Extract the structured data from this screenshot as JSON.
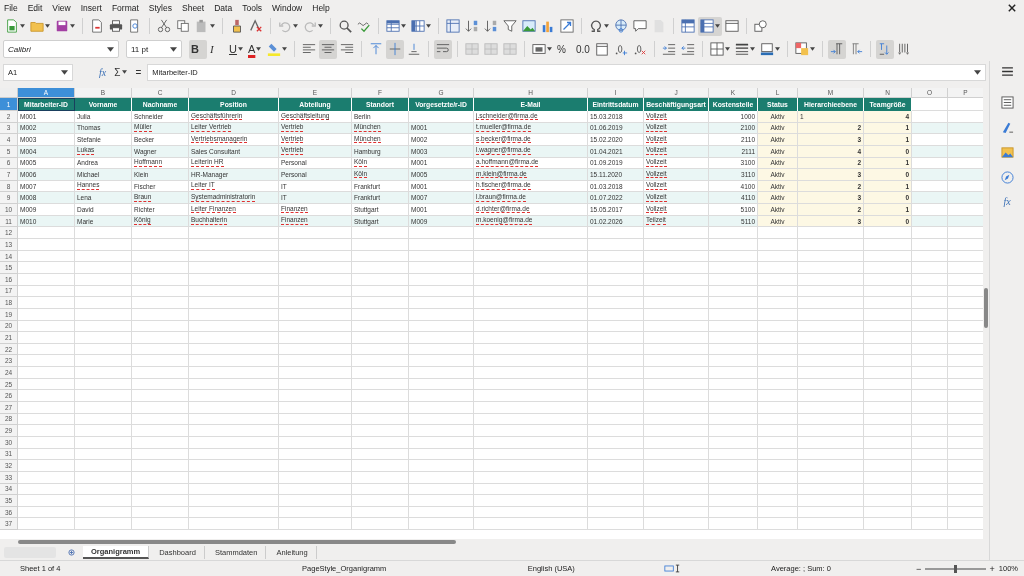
{
  "menu": [
    "File",
    "Edit",
    "View",
    "Insert",
    "Format",
    "Styles",
    "Sheet",
    "Data",
    "Tools",
    "Window",
    "Help"
  ],
  "standard_toolbar": {
    "groups": [
      [
        {
          "kind": "new",
          "pressed": false,
          "menu": true
        },
        {
          "kind": "open",
          "pressed": false,
          "menu": true
        },
        {
          "kind": "save",
          "pressed": false,
          "menu": true
        }
      ],
      [
        {
          "kind": "pdf",
          "pressed": false,
          "menu": false
        },
        {
          "kind": "print",
          "pressed": false,
          "menu": false
        },
        {
          "kind": "preview",
          "pressed": false,
          "menu": false
        }
      ],
      [
        {
          "kind": "cut",
          "pressed": false,
          "menu": false
        },
        {
          "kind": "copy",
          "pressed": false,
          "menu": false
        },
        {
          "kind": "paste",
          "pressed": false,
          "menu": true
        }
      ],
      [
        {
          "kind": "clone",
          "pressed": false,
          "menu": false
        },
        {
          "kind": "clear",
          "pressed": false,
          "menu": false
        }
      ],
      [
        {
          "kind": "undo",
          "pressed": false,
          "menu": true
        },
        {
          "kind": "redo",
          "pressed": false,
          "menu": true
        }
      ],
      [
        {
          "kind": "find",
          "pressed": false,
          "menu": false
        },
        {
          "kind": "spell",
          "pressed": false,
          "menu": false
        }
      ],
      [
        {
          "kind": "rows",
          "pressed": false,
          "menu": true
        },
        {
          "kind": "columns",
          "pressed": false,
          "menu": true
        }
      ],
      [
        {
          "kind": "headers",
          "pressed": false,
          "menu": false
        },
        {
          "kind": "sort-up",
          "pressed": false,
          "menu": false
        },
        {
          "kind": "sort-down",
          "pressed": false,
          "menu": false
        },
        {
          "kind": "filter",
          "pressed": false,
          "menu": false
        },
        {
          "kind": "image",
          "pressed": false,
          "menu": false
        },
        {
          "kind": "chart",
          "pressed": false,
          "menu": false
        },
        {
          "kind": "pivot",
          "pressed": false,
          "menu": false
        }
      ],
      [
        {
          "kind": "omega",
          "pressed": false,
          "menu": true
        },
        {
          "kind": "globe",
          "pressed": false,
          "menu": false
        },
        {
          "kind": "comment",
          "pressed": false,
          "menu": false
        },
        {
          "kind": "page",
          "pressed": false,
          "menu": false
        }
      ],
      [
        {
          "kind": "freeze",
          "pressed": false,
          "menu": false
        },
        {
          "kind": "split",
          "pressed": true,
          "menu": true
        },
        {
          "kind": "window",
          "pressed": false,
          "menu": false
        }
      ],
      [
        {
          "kind": "shapes",
          "pressed": false,
          "menu": false
        }
      ]
    ]
  },
  "formatting_toolbar": {
    "font_name": "Calibri",
    "font_size": "11 pt",
    "groups": [
      [
        {
          "kind": "bold",
          "label": "B",
          "pressed": true,
          "menu": false
        },
        {
          "kind": "italic",
          "label": "I",
          "pressed": false,
          "menu": false
        },
        {
          "kind": "underline",
          "label": "U",
          "pressed": false,
          "menu": true
        },
        {
          "kind": "font-color",
          "label": "A",
          "pressed": false,
          "menu": true
        },
        {
          "kind": "highlight",
          "pressed": false,
          "menu": true
        }
      ],
      [
        {
          "kind": "align-left",
          "pressed": false,
          "menu": false
        },
        {
          "kind": "align-center",
          "pressed": true,
          "menu": false
        },
        {
          "kind": "align-right",
          "pressed": false,
          "menu": false
        }
      ],
      [
        {
          "kind": "align-top",
          "pressed": false,
          "menu": false
        },
        {
          "kind": "align-middle",
          "pressed": true,
          "menu": false
        },
        {
          "kind": "align-bottom",
          "pressed": false,
          "menu": false
        }
      ],
      [
        {
          "kind": "wrap",
          "pressed": true,
          "menu": false
        }
      ],
      [
        {
          "kind": "merge",
          "pressed": false,
          "menu": false
        },
        {
          "kind": "merge",
          "pressed": false,
          "menu": false
        },
        {
          "kind": "merge",
          "pressed": false,
          "menu": false
        }
      ],
      [
        {
          "kind": "currency",
          "pressed": false,
          "menu": true
        },
        {
          "kind": "percent",
          "label": "%",
          "pressed": false,
          "menu": false
        },
        {
          "kind": "decimal",
          "label": "0.0",
          "pressed": false,
          "menu": false
        },
        {
          "kind": "date",
          "pressed": false,
          "menu": false
        },
        {
          "kind": "add-decimal",
          "pressed": false,
          "menu": false
        },
        {
          "kind": "remove-decimal",
          "pressed": false,
          "menu": false
        }
      ],
      [
        {
          "kind": "indent",
          "pressed": false,
          "menu": false
        },
        {
          "kind": "outdent",
          "pressed": false,
          "menu": false
        }
      ],
      [
        {
          "kind": "borders",
          "pressed": false,
          "menu": true
        },
        {
          "kind": "border-style",
          "pressed": false,
          "menu": true
        },
        {
          "kind": "border-color",
          "pressed": false,
          "menu": true
        }
      ],
      [
        {
          "kind": "conditional",
          "pressed": false,
          "menu": true
        }
      ],
      [
        {
          "kind": "ltr",
          "pressed": true,
          "menu": false
        },
        {
          "kind": "rtl",
          "pressed": false,
          "menu": false
        }
      ],
      [
        {
          "kind": "stack",
          "pressed": true,
          "menu": false
        },
        {
          "kind": "vertical",
          "pressed": false,
          "menu": false
        }
      ]
    ]
  },
  "formula_bar": {
    "cell": "A1",
    "function_wizard": "fx",
    "sum": "Σ",
    "equals": "=",
    "content": "Mitarbeiter-ID"
  },
  "sidebar": {
    "functions": "fx"
  },
  "sheet": {
    "columns": [
      {
        "label": "A",
        "selected": true
      },
      {
        "label": "B",
        "selected": false
      },
      {
        "label": "C",
        "selected": false
      },
      {
        "label": "D",
        "selected": false
      },
      {
        "label": "E",
        "selected": false
      },
      {
        "label": "F",
        "selected": false
      },
      {
        "label": "G",
        "selected": false
      },
      {
        "label": "H",
        "selected": false
      },
      {
        "label": "I",
        "selected": false
      },
      {
        "label": "J",
        "selected": false
      },
      {
        "label": "K",
        "selected": false
      },
      {
        "label": "L",
        "selected": false
      },
      {
        "label": "M",
        "selected": false
      },
      {
        "label": "N",
        "selected": false
      },
      {
        "label": "O",
        "selected": false
      },
      {
        "label": "P",
        "selected": false
      }
    ],
    "row_numbers": [
      {
        "label": "1",
        "selected": true
      },
      {
        "label": "2",
        "selected": false
      },
      {
        "label": "3",
        "selected": false
      },
      {
        "label": "4",
        "selected": false
      },
      {
        "label": "5",
        "selected": false
      },
      {
        "label": "6",
        "selected": false
      },
      {
        "label": "7",
        "selected": false
      },
      {
        "label": "8",
        "selected": false
      },
      {
        "label": "9",
        "selected": false
      },
      {
        "label": "10",
        "selected": false
      },
      {
        "label": "11",
        "selected": false
      },
      {
        "label": "12",
        "selected": false
      },
      {
        "label": "13",
        "selected": false
      },
      {
        "label": "14",
        "selected": false
      },
      {
        "label": "15",
        "selected": false
      },
      {
        "label": "16",
        "selected": false
      },
      {
        "label": "17",
        "selected": false
      },
      {
        "label": "18",
        "selected": false
      },
      {
        "label": "19",
        "selected": false
      },
      {
        "label": "20",
        "selected": false
      },
      {
        "label": "21",
        "selected": false
      },
      {
        "label": "22",
        "selected": false
      },
      {
        "label": "23",
        "selected": false
      },
      {
        "label": "24",
        "selected": false
      },
      {
        "label": "25",
        "selected": false
      },
      {
        "label": "26",
        "selected": false
      },
      {
        "label": "27",
        "selected": false
      },
      {
        "label": "28",
        "selected": false
      },
      {
        "label": "29",
        "selected": false
      },
      {
        "label": "30",
        "selected": false
      },
      {
        "label": "31",
        "selected": false
      },
      {
        "label": "32",
        "selected": false
      },
      {
        "label": "33",
        "selected": false
      },
      {
        "label": "34",
        "selected": false
      },
      {
        "label": "35",
        "selected": false
      },
      {
        "label": "36",
        "selected": false
      },
      {
        "label": "37",
        "selected": false
      }
    ],
    "header": [
      {
        "text": "Mitarbeiter-ID",
        "selected": true
      },
      {
        "text": "Vorname",
        "selected": false
      },
      {
        "text": "Nachname",
        "selected": false
      },
      {
        "text": "Position",
        "selected": false
      },
      {
        "text": "Abteilung",
        "selected": false
      },
      {
        "text": "Standort",
        "selected": false
      },
      {
        "text": "Vorgesetzte/r-ID",
        "selected": false
      },
      {
        "text": "E-Mail",
        "selected": false
      },
      {
        "text": "Eintrittsdatum",
        "selected": false
      },
      {
        "text": "Beschäftigungsart",
        "selected": false
      },
      {
        "text": "Kostenstelle",
        "selected": false
      },
      {
        "text": "Status",
        "selected": false
      },
      {
        "text": "Hierarchieebene",
        "selected": false
      },
      {
        "text": "Teamgröße",
        "selected": false
      }
    ],
    "rows": [
      {
        "cells": [
          {
            "text": "M001",
            "misspelled": false,
            "kind": "text"
          },
          {
            "text": "Julia",
            "misspelled": false,
            "kind": "text"
          },
          {
            "text": "Schneider",
            "misspelled": false,
            "kind": "text"
          },
          {
            "text": "Geschäftsführerin",
            "misspelled": true,
            "kind": "text"
          },
          {
            "text": "Geschäftsleitung",
            "misspelled": true,
            "kind": "text"
          },
          {
            "text": "Berlin",
            "misspelled": false,
            "kind": "text"
          },
          null,
          {
            "text": "j.schneider@firma.de",
            "misspelled": true,
            "kind": "text"
          },
          {
            "text": "15.03.2018",
            "misspelled": false,
            "kind": "text"
          },
          {
            "text": "Vollzeit",
            "misspelled": true,
            "kind": "text"
          },
          {
            "text": "1000",
            "misspelled": false,
            "kind": "number"
          },
          {
            "text": "Aktiv",
            "misspelled": false,
            "kind": "text"
          },
          {
            "text": "1",
            "misspelled": false,
            "kind": "text"
          },
          {
            "text": "4",
            "misspelled": false,
            "kind": "number"
          }
        ]
      },
      {
        "cells": [
          {
            "text": "M002",
            "misspelled": false,
            "kind": "text"
          },
          {
            "text": "Thomas",
            "misspelled": false,
            "kind": "text"
          },
          {
            "text": "Müller",
            "misspelled": true,
            "kind": "text"
          },
          {
            "text": "Leiter Vertrieb",
            "misspelled": true,
            "kind": "text"
          },
          {
            "text": "Vertrieb",
            "misspelled": true,
            "kind": "text"
          },
          {
            "text": "München",
            "misspelled": true,
            "kind": "text"
          },
          {
            "text": "M001",
            "misspelled": false,
            "kind": "text"
          },
          {
            "text": "t.mueller@firma.de",
            "misspelled": true,
            "kind": "text"
          },
          {
            "text": "01.06.2019",
            "misspelled": false,
            "kind": "text"
          },
          {
            "text": "Vollzeit",
            "misspelled": true,
            "kind": "text"
          },
          {
            "text": "2100",
            "misspelled": false,
            "kind": "number"
          },
          {
            "text": "Aktiv",
            "misspelled": false,
            "kind": "text"
          },
          {
            "text": "2",
            "misspelled": false,
            "kind": "number"
          },
          {
            "text": "1",
            "misspelled": false,
            "kind": "number"
          }
        ]
      },
      {
        "cells": [
          {
            "text": "M003",
            "misspelled": false,
            "kind": "text"
          },
          {
            "text": "Stefanie",
            "misspelled": false,
            "kind": "text"
          },
          {
            "text": "Becker",
            "misspelled": false,
            "kind": "text"
          },
          {
            "text": "Vertriebsmanagerin",
            "misspelled": true,
            "kind": "text"
          },
          {
            "text": "Vertrieb",
            "misspelled": true,
            "kind": "text"
          },
          {
            "text": "München",
            "misspelled": true,
            "kind": "text"
          },
          {
            "text": "M002",
            "misspelled": false,
            "kind": "text"
          },
          {
            "text": "s.becker@firma.de",
            "misspelled": true,
            "kind": "text"
          },
          {
            "text": "15.02.2020",
            "misspelled": false,
            "kind": "text"
          },
          {
            "text": "Vollzeit",
            "misspelled": true,
            "kind": "text"
          },
          {
            "text": "2110",
            "misspelled": false,
            "kind": "number"
          },
          {
            "text": "Aktiv",
            "misspelled": false,
            "kind": "text"
          },
          {
            "text": "3",
            "misspelled": false,
            "kind": "number"
          },
          {
            "text": "1",
            "misspelled": false,
            "kind": "number"
          }
        ]
      },
      {
        "cells": [
          {
            "text": "M004",
            "misspelled": false,
            "kind": "text"
          },
          {
            "text": "Lukas",
            "misspelled": true,
            "kind": "text"
          },
          {
            "text": "Wagner",
            "misspelled": false,
            "kind": "text"
          },
          {
            "text": "Sales Consultant",
            "misspelled": false,
            "kind": "text"
          },
          {
            "text": "Vertrieb",
            "misspelled": true,
            "kind": "text"
          },
          {
            "text": "Hamburg",
            "misspelled": false,
            "kind": "text"
          },
          {
            "text": "M003",
            "misspelled": false,
            "kind": "text"
          },
          {
            "text": "l.wagner@firma.de",
            "misspelled": true,
            "kind": "text"
          },
          {
            "text": "01.04.2021",
            "misspelled": false,
            "kind": "text"
          },
          {
            "text": "Vollzeit",
            "misspelled": true,
            "kind": "text"
          },
          {
            "text": "2111",
            "misspelled": false,
            "kind": "number"
          },
          {
            "text": "Aktiv",
            "misspelled": false,
            "kind": "text"
          },
          {
            "text": "4",
            "misspelled": false,
            "kind": "number"
          },
          {
            "text": "0",
            "misspelled": false,
            "kind": "number"
          }
        ]
      },
      {
        "cells": [
          {
            "text": "M005",
            "misspelled": false,
            "kind": "text"
          },
          {
            "text": "Andrea",
            "misspelled": false,
            "kind": "text"
          },
          {
            "text": "Hoffmann",
            "misspelled": true,
            "kind": "text"
          },
          {
            "text": "Leiterin HR",
            "misspelled": true,
            "kind": "text"
          },
          {
            "text": "Personal",
            "misspelled": false,
            "kind": "text"
          },
          {
            "text": "Köln",
            "misspelled": true,
            "kind": "text"
          },
          {
            "text": "M001",
            "misspelled": false,
            "kind": "text"
          },
          {
            "text": "a.hoffmann@firma.de",
            "misspelled": true,
            "kind": "text"
          },
          {
            "text": "01.09.2019",
            "misspelled": false,
            "kind": "text"
          },
          {
            "text": "Vollzeit",
            "misspelled": true,
            "kind": "text"
          },
          {
            "text": "3100",
            "misspelled": false,
            "kind": "number"
          },
          {
            "text": "Aktiv",
            "misspelled": false,
            "kind": "text"
          },
          {
            "text": "2",
            "misspelled": false,
            "kind": "number"
          },
          {
            "text": "1",
            "misspelled": false,
            "kind": "number"
          }
        ]
      },
      {
        "cells": [
          {
            "text": "M006",
            "misspelled": false,
            "kind": "text"
          },
          {
            "text": "Michael",
            "misspelled": false,
            "kind": "text"
          },
          {
            "text": "Klein",
            "misspelled": false,
            "kind": "text"
          },
          {
            "text": "HR-Manager",
            "misspelled": false,
            "kind": "text"
          },
          {
            "text": "Personal",
            "misspelled": false,
            "kind": "text"
          },
          {
            "text": "Köln",
            "misspelled": true,
            "kind": "text"
          },
          {
            "text": "M005",
            "misspelled": false,
            "kind": "text"
          },
          {
            "text": "m.klein@firma.de",
            "misspelled": true,
            "kind": "text"
          },
          {
            "text": "15.11.2020",
            "misspelled": false,
            "kind": "text"
          },
          {
            "text": "Vollzeit",
            "misspelled": true,
            "kind": "text"
          },
          {
            "text": "3110",
            "misspelled": false,
            "kind": "number"
          },
          {
            "text": "Aktiv",
            "misspelled": false,
            "kind": "text"
          },
          {
            "text": "3",
            "misspelled": false,
            "kind": "number"
          },
          {
            "text": "0",
            "misspelled": false,
            "kind": "number"
          }
        ]
      },
      {
        "cells": [
          {
            "text": "M007",
            "misspelled": false,
            "kind": "text"
          },
          {
            "text": "Hannes",
            "misspelled": true,
            "kind": "text"
          },
          {
            "text": "Fischer",
            "misspelled": false,
            "kind": "text"
          },
          {
            "text": "Leiter IT",
            "misspelled": true,
            "kind": "text"
          },
          {
            "text": "IT",
            "misspelled": false,
            "kind": "text"
          },
          {
            "text": "Frankfurt",
            "misspelled": false,
            "kind": "text"
          },
          {
            "text": "M001",
            "misspelled": false,
            "kind": "text"
          },
          {
            "text": "h.fischer@firma.de",
            "misspelled": true,
            "kind": "text"
          },
          {
            "text": "01.03.2018",
            "misspelled": false,
            "kind": "text"
          },
          {
            "text": "Vollzeit",
            "misspelled": true,
            "kind": "text"
          },
          {
            "text": "4100",
            "misspelled": false,
            "kind": "number"
          },
          {
            "text": "Aktiv",
            "misspelled": false,
            "kind": "text"
          },
          {
            "text": "2",
            "misspelled": false,
            "kind": "number"
          },
          {
            "text": "1",
            "misspelled": false,
            "kind": "number"
          }
        ]
      },
      {
        "cells": [
          {
            "text": "M008",
            "misspelled": false,
            "kind": "text"
          },
          {
            "text": "Lena",
            "misspelled": false,
            "kind": "text"
          },
          {
            "text": "Braun",
            "misspelled": true,
            "kind": "text"
          },
          {
            "text": "Systemadministratorin",
            "misspelled": true,
            "kind": "text"
          },
          {
            "text": "IT",
            "misspelled": false,
            "kind": "text"
          },
          {
            "text": "Frankfurt",
            "misspelled": false,
            "kind": "text"
          },
          {
            "text": "M007",
            "misspelled": false,
            "kind": "text"
          },
          {
            "text": "l.braun@firma.de",
            "misspelled": true,
            "kind": "text"
          },
          {
            "text": "01.07.2022",
            "misspelled": false,
            "kind": "text"
          },
          {
            "text": "Vollzeit",
            "misspelled": true,
            "kind": "text"
          },
          {
            "text": "4110",
            "misspelled": false,
            "kind": "number"
          },
          {
            "text": "Aktiv",
            "misspelled": false,
            "kind": "text"
          },
          {
            "text": "3",
            "misspelled": false,
            "kind": "number"
          },
          {
            "text": "0",
            "misspelled": false,
            "kind": "number"
          }
        ]
      },
      {
        "cells": [
          {
            "text": "M009",
            "misspelled": false,
            "kind": "text"
          },
          {
            "text": "David",
            "misspelled": false,
            "kind": "text"
          },
          {
            "text": "Richter",
            "misspelled": false,
            "kind": "text"
          },
          {
            "text": "Leiter Finanzen",
            "misspelled": true,
            "kind": "text"
          },
          {
            "text": "Finanzen",
            "misspelled": true,
            "kind": "text"
          },
          {
            "text": "Stuttgart",
            "misspelled": false,
            "kind": "text"
          },
          {
            "text": "M001",
            "misspelled": false,
            "kind": "text"
          },
          {
            "text": "d.richter@firma.de",
            "misspelled": true,
            "kind": "text"
          },
          {
            "text": "15.05.2017",
            "misspelled": false,
            "kind": "text"
          },
          {
            "text": "Vollzeit",
            "misspelled": true,
            "kind": "text"
          },
          {
            "text": "5100",
            "misspelled": false,
            "kind": "number"
          },
          {
            "text": "Aktiv",
            "misspelled": false,
            "kind": "text"
          },
          {
            "text": "2",
            "misspelled": false,
            "kind": "number"
          },
          {
            "text": "1",
            "misspelled": false,
            "kind": "number"
          }
        ]
      },
      {
        "cells": [
          {
            "text": "M010",
            "misspelled": false,
            "kind": "text"
          },
          {
            "text": "Marie",
            "misspelled": false,
            "kind": "text"
          },
          {
            "text": "König",
            "misspelled": true,
            "kind": "text"
          },
          {
            "text": "Buchhalterin",
            "misspelled": true,
            "kind": "text"
          },
          {
            "text": "Finanzen",
            "misspelled": true,
            "kind": "text"
          },
          {
            "text": "Stuttgart",
            "misspelled": false,
            "kind": "text"
          },
          {
            "text": "M009",
            "misspelled": false,
            "kind": "text"
          },
          {
            "text": "m.koenig@firma.de",
            "misspelled": true,
            "kind": "text"
          },
          {
            "text": "01.02.2026",
            "misspelled": false,
            "kind": "text"
          },
          {
            "text": "Teilzeit",
            "misspelled": true,
            "kind": "text"
          },
          {
            "text": "5110",
            "misspelled": false,
            "kind": "number"
          },
          {
            "text": "Aktiv",
            "misspelled": false,
            "kind": "text"
          },
          {
            "text": "3",
            "misspelled": false,
            "kind": "number"
          },
          {
            "text": "0",
            "misspelled": false,
            "kind": "number"
          }
        ]
      }
    ]
  },
  "sheet_tabs": [
    {
      "label": "Organigramm",
      "selected": true
    },
    {
      "label": "Dashboard",
      "selected": false
    },
    {
      "label": "Stammdaten",
      "selected": false
    },
    {
      "label": "Anleitung",
      "selected": false
    }
  ],
  "status_bar": {
    "sheet": "Sheet 1 of 4",
    "page_style": "PageStyle_Organigramm",
    "language": "English (USA)",
    "summary": "Average: ; Sum: 0",
    "zoom_out": "−",
    "zoom": {
      "level": 0.5
    },
    "zoom_in": "+",
    "zoom_text": "100%"
  }
}
